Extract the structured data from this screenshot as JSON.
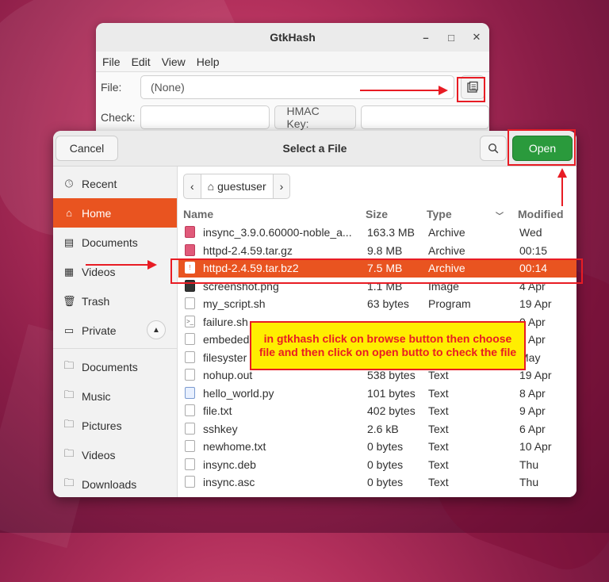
{
  "gtkhash": {
    "title": "GtkHash",
    "controls": {
      "minimize": "–",
      "maximize": "□",
      "close": "✕"
    },
    "menu": [
      "File",
      "Edit",
      "View",
      "Help"
    ],
    "file_label": "File:",
    "file_value": "(None)",
    "check_label": "Check:",
    "hmac_label": "HMAC Key:"
  },
  "dialog": {
    "cancel": "Cancel",
    "title": "Select a File",
    "open": "Open",
    "path_segment": "guestuser",
    "sidebar": {
      "places": [
        {
          "label": "Recent",
          "icon": "clock-icon"
        },
        {
          "label": "Home",
          "icon": "home-icon",
          "active": true
        },
        {
          "label": "Documents",
          "icon": "document-icon"
        },
        {
          "label": "Videos",
          "icon": "film-icon"
        },
        {
          "label": "Trash",
          "icon": "trash-icon"
        },
        {
          "label": "Private",
          "icon": "drive-icon"
        }
      ],
      "bookmarks": [
        {
          "label": "Documents",
          "icon": "folder-icon"
        },
        {
          "label": "Music",
          "icon": "folder-icon"
        },
        {
          "label": "Pictures",
          "icon": "folder-icon"
        },
        {
          "label": "Videos",
          "icon": "folder-icon"
        },
        {
          "label": "Downloads",
          "icon": "folder-icon"
        }
      ]
    },
    "columns": {
      "name": "Name",
      "size": "Size",
      "type": "Type",
      "modified": "Modified"
    },
    "files": [
      {
        "name": "insync_3.9.0.60000-noble_a...",
        "size": "163.3 MB",
        "type": "Archive",
        "modified": "Wed",
        "icon": "archive"
      },
      {
        "name": "httpd-2.4.59.tar.gz",
        "size": "9.8 MB",
        "type": "Archive",
        "modified": "00:15",
        "icon": "archive"
      },
      {
        "name": "httpd-2.4.59.tar.bz2",
        "size": "7.5 MB",
        "type": "Archive",
        "modified": "00:14",
        "icon": "archive",
        "selected": true
      },
      {
        "name": "screenshot.png",
        "size": "1.1 MB",
        "type": "Image",
        "modified": "4 Apr",
        "icon": "image"
      },
      {
        "name": "my_script.sh",
        "size": "63 bytes",
        "type": "Program",
        "modified": "19 Apr",
        "icon": "text"
      },
      {
        "name": "failure.sh",
        "size": "",
        "type": "",
        "modified": "0 Apr",
        "icon": "script"
      },
      {
        "name": "embeded",
        "size": "",
        "type": "",
        "modified": "9 Apr",
        "icon": "text"
      },
      {
        "name": "filesyster",
        "size": "",
        "type": "",
        "modified": "May",
        "icon": "text"
      },
      {
        "name": "nohup.out",
        "size": "538 bytes",
        "type": "Text",
        "modified": "19 Apr",
        "icon": "text"
      },
      {
        "name": "hello_world.py",
        "size": "101 bytes",
        "type": "Text",
        "modified": "8 Apr",
        "icon": "py"
      },
      {
        "name": "file.txt",
        "size": "402 bytes",
        "type": "Text",
        "modified": "9 Apr",
        "icon": "text"
      },
      {
        "name": "sshkey",
        "size": "2.6 kB",
        "type": "Text",
        "modified": "6 Apr",
        "icon": "text"
      },
      {
        "name": "newhome.txt",
        "size": "0 bytes",
        "type": "Text",
        "modified": "10 Apr",
        "icon": "text"
      },
      {
        "name": "insync.deb",
        "size": "0 bytes",
        "type": "Text",
        "modified": "Thu",
        "icon": "text"
      },
      {
        "name": "insync.asc",
        "size": "0 bytes",
        "type": "Text",
        "modified": "Thu",
        "icon": "text"
      }
    ]
  },
  "annotation": {
    "callout": "in gtkhash click on browse button then choose file and then click on open butto to check the file",
    "color": "#e81c24"
  }
}
